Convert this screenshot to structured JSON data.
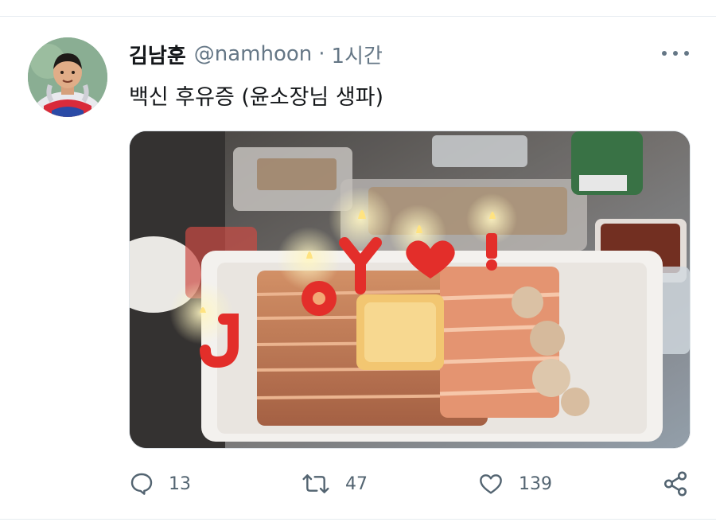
{
  "tweet": {
    "author": {
      "display_name": "김남훈",
      "handle": "@namhoon",
      "avatar": "avatar-cartoon-icon"
    },
    "separator": "·",
    "timestamp": "1시간",
    "text": "백신 후유증 (윤소장님 생파)",
    "more_icon": "more-horizontal-icon",
    "media": {
      "description_icon": "photo-icon",
      "candle_letters": [
        "J",
        "O",
        "Y",
        "♥",
        "!"
      ]
    },
    "actions": {
      "reply": {
        "icon": "reply-icon",
        "count": "13"
      },
      "retweet": {
        "icon": "retweet-icon",
        "count": "47"
      },
      "like": {
        "icon": "like-icon",
        "count": "139"
      },
      "share": {
        "icon": "share-icon"
      }
    }
  },
  "colors": {
    "text_primary": "#14171a",
    "text_secondary": "#657786",
    "icon_gray": "#536471",
    "divider": "#e6ecf0",
    "candle_red": "#e2231f"
  }
}
